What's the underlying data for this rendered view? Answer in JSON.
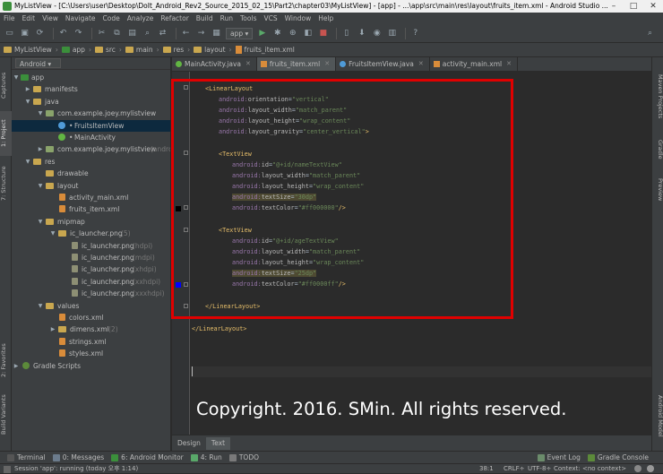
{
  "window": {
    "title": "MyListView - [C:\\Users\\user\\Desktop\\DoIt_Android_Rev2_Source_2015_02_15\\Part2\\chapter03\\MyListView] - [app] - ...\\app\\src\\main\\res\\layout\\fruits_item.xml - Android Studio ...",
    "controls": [
      "–",
      "□",
      "✕"
    ]
  },
  "menu": [
    "File",
    "Edit",
    "View",
    "Navigate",
    "Code",
    "Analyze",
    "Refactor",
    "Build",
    "Run",
    "Tools",
    "VCS",
    "Window",
    "Help"
  ],
  "toolbar": {
    "run_config": "app ▾"
  },
  "breadcrumbs": [
    "MyListView",
    "app",
    "src",
    "main",
    "res",
    "layout",
    "fruits_item.xml"
  ],
  "left_strip": {
    "captures": "Captures",
    "project": "1: Project",
    "structure": "7: Structure",
    "favorites": "2: Favorites",
    "build_variants": "Build Variants"
  },
  "right_strip": {
    "maven": "Maven Projects",
    "gradle": "Gradle",
    "preview": "Preview",
    "android_model": "Android Model"
  },
  "project": {
    "view_mode": "Android",
    "tree": [
      {
        "label": "app",
        "dim": ""
      },
      {
        "label": "manifests",
        "dim": ""
      },
      {
        "label": "java",
        "dim": ""
      },
      {
        "label": "com.example.joey.mylistview",
        "dim": ""
      },
      {
        "label": "FruitsItemView",
        "dim": ""
      },
      {
        "label": "MainActivity",
        "dim": ""
      },
      {
        "label": "com.example.joey.mylistview",
        "dim": "(andro"
      },
      {
        "label": "res",
        "dim": ""
      },
      {
        "label": "drawable",
        "dim": ""
      },
      {
        "label": "layout",
        "dim": ""
      },
      {
        "label": "activity_main.xml",
        "dim": ""
      },
      {
        "label": "fruits_item.xml",
        "dim": ""
      },
      {
        "label": "mipmap",
        "dim": ""
      },
      {
        "label": "ic_launcher.png",
        "dim": "(5)"
      },
      {
        "label": "ic_launcher.png",
        "dim": "(hdpi)"
      },
      {
        "label": "ic_launcher.png",
        "dim": "(mdpi)"
      },
      {
        "label": "ic_launcher.png",
        "dim": "(xhdpi)"
      },
      {
        "label": "ic_launcher.png",
        "dim": "(xxhdpi)"
      },
      {
        "label": "ic_launcher.png",
        "dim": "(xxxhdpi)"
      },
      {
        "label": "values",
        "dim": ""
      },
      {
        "label": "colors.xml",
        "dim": ""
      },
      {
        "label": "dimens.xml",
        "dim": "(2)"
      },
      {
        "label": "strings.xml",
        "dim": ""
      },
      {
        "label": "styles.xml",
        "dim": ""
      },
      {
        "label": "Gradle Scripts",
        "dim": ""
      }
    ]
  },
  "tabs": [
    "MainActivity.java",
    "fruits_item.xml",
    "FruitsItemView.java",
    "activity_main.xml"
  ],
  "code": {
    "l1_tag": "<LinearLayout",
    "l2": [
      "android:",
      "orientation",
      "=",
      "\"vertical\""
    ],
    "l3": [
      "android:",
      "layout_width",
      "=",
      "\"match_parent\""
    ],
    "l4": [
      "android:",
      "layout_height",
      "=",
      "\"wrap_content\""
    ],
    "l5": [
      "android:",
      "layout_gravity",
      "=",
      "\"center_vertical\"",
      ">"
    ],
    "tv1_tag": "<TextView",
    "tv1_id": [
      "android:",
      "id",
      "=",
      "\"@+id/nameTextView\""
    ],
    "tv1_w": [
      "android:",
      "layout_width",
      "=",
      "\"match_parent\""
    ],
    "tv1_h": [
      "android:",
      "layout_height",
      "=",
      "\"wrap_content\""
    ],
    "tv1_size": [
      "android:",
      "textSize",
      "=",
      "\"30dp\""
    ],
    "tv1_color": [
      "android:",
      "textColor",
      "=",
      "\"#ff000000\"",
      "/>"
    ],
    "tv2_tag": "<TextView",
    "tv2_id": [
      "android:",
      "id",
      "=",
      "\"@+id/ageTextView\""
    ],
    "tv2_w": [
      "android:",
      "layout_width",
      "=",
      "\"match_parent\""
    ],
    "tv2_h": [
      "android:",
      "layout_height",
      "=",
      "\"wrap_content\""
    ],
    "tv2_size": [
      "android:",
      "textSize",
      "=",
      "\"25dp\""
    ],
    "tv2_color": [
      "android:",
      "textColor",
      "=",
      "\"#ff0000ff\"",
      "/>"
    ],
    "close_inner": "</LinearLayout>",
    "close_outer": "</LinearLayout>",
    "marker_colors": [
      "#000000",
      "#0000ff"
    ]
  },
  "overlay": {
    "copyright": "Copyright. 2016. SMin. All rights reserved.",
    "highlight_color": "#e00000"
  },
  "design_tabs": [
    "Design",
    "Text"
  ],
  "tool_windows": {
    "left": [
      "Terminal",
      "0: Messages",
      "6: Android Monitor",
      "4: Run",
      "TODO"
    ],
    "right": [
      "Event Log",
      "Gradle Console"
    ]
  },
  "status": {
    "message": "Session 'app': running (today 오후 1:14)",
    "position": "38:1",
    "line_sep": "CRLF÷",
    "encoding": "UTF-8÷",
    "context": "Context: <no context>"
  }
}
